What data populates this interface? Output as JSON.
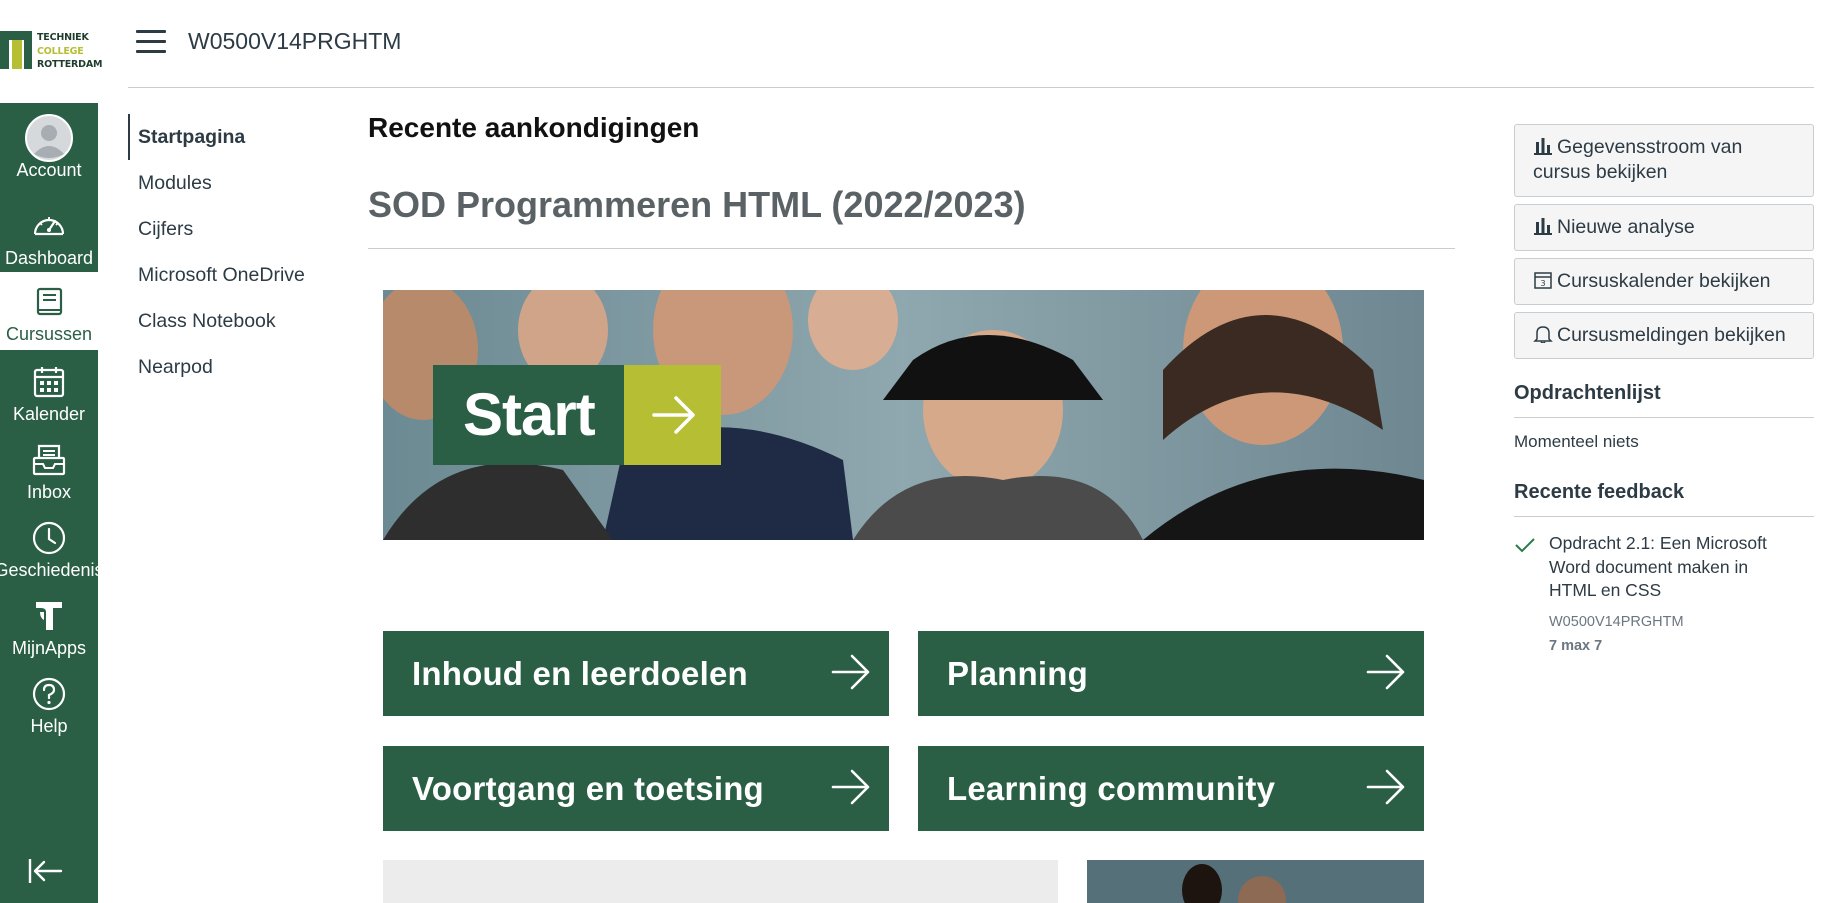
{
  "logo": {
    "line1": "TECHNIEK",
    "line2": "COLLEGE",
    "line3": "ROTTERDAM"
  },
  "global_nav": {
    "items": [
      {
        "label": "Account",
        "icon": "avatar-icon"
      },
      {
        "label": "Dashboard",
        "icon": "speedometer-icon"
      },
      {
        "label": "Cursussen",
        "icon": "book-icon",
        "active": true
      },
      {
        "label": "Kalender",
        "icon": "calendar-icon"
      },
      {
        "label": "Inbox",
        "icon": "inbox-icon"
      },
      {
        "label": "Geschiedenis",
        "icon": "clock-icon"
      },
      {
        "label": "MijnApps",
        "icon": "apps-logo-icon"
      },
      {
        "label": "Help",
        "icon": "help-icon"
      }
    ],
    "collapse_icon": "collapse-arrow-icon"
  },
  "header": {
    "course_code": "W0500V14PRGHTM"
  },
  "course_nav": {
    "items": [
      {
        "label": "Startpagina",
        "active": true
      },
      {
        "label": "Modules"
      },
      {
        "label": "Cijfers"
      },
      {
        "label": "Microsoft OneDrive"
      },
      {
        "label": "Class Notebook"
      },
      {
        "label": "Nearpod"
      }
    ]
  },
  "main": {
    "recent_announcements": "Recente aankondigingen",
    "course_title": "SOD Programmeren HTML (2022/2023)",
    "banner_button": "Start",
    "tiles": [
      {
        "label": "Inhoud en leerdoelen"
      },
      {
        "label": "Planning"
      },
      {
        "label": "Voortgang en toetsing"
      },
      {
        "label": "Learning community"
      }
    ]
  },
  "right_sidebar": {
    "buttons": [
      {
        "label": "Gegevensstroom van cursus bekijken",
        "icon": "bar-chart-icon"
      },
      {
        "label": "Nieuwe analyse",
        "icon": "bar-chart-icon"
      },
      {
        "label": "Cursuskalender bekijken",
        "icon": "calendar-icon"
      },
      {
        "label": "Cursusmeldingen bekijken",
        "icon": "bell-icon"
      }
    ],
    "todo_heading": "Opdrachtenlijst",
    "todo_empty": "Momenteel niets",
    "feedback_heading": "Recente feedback",
    "feedback": {
      "title": "Opdracht 2.1: Een Microsoft Word document maken in HTML en CSS",
      "course": "W0500V14PRGHTM",
      "score": "7 max 7"
    }
  },
  "colors": {
    "brand_green": "#2a5f45",
    "brand_lime": "#b6bf34",
    "text": "#2d3b45"
  }
}
